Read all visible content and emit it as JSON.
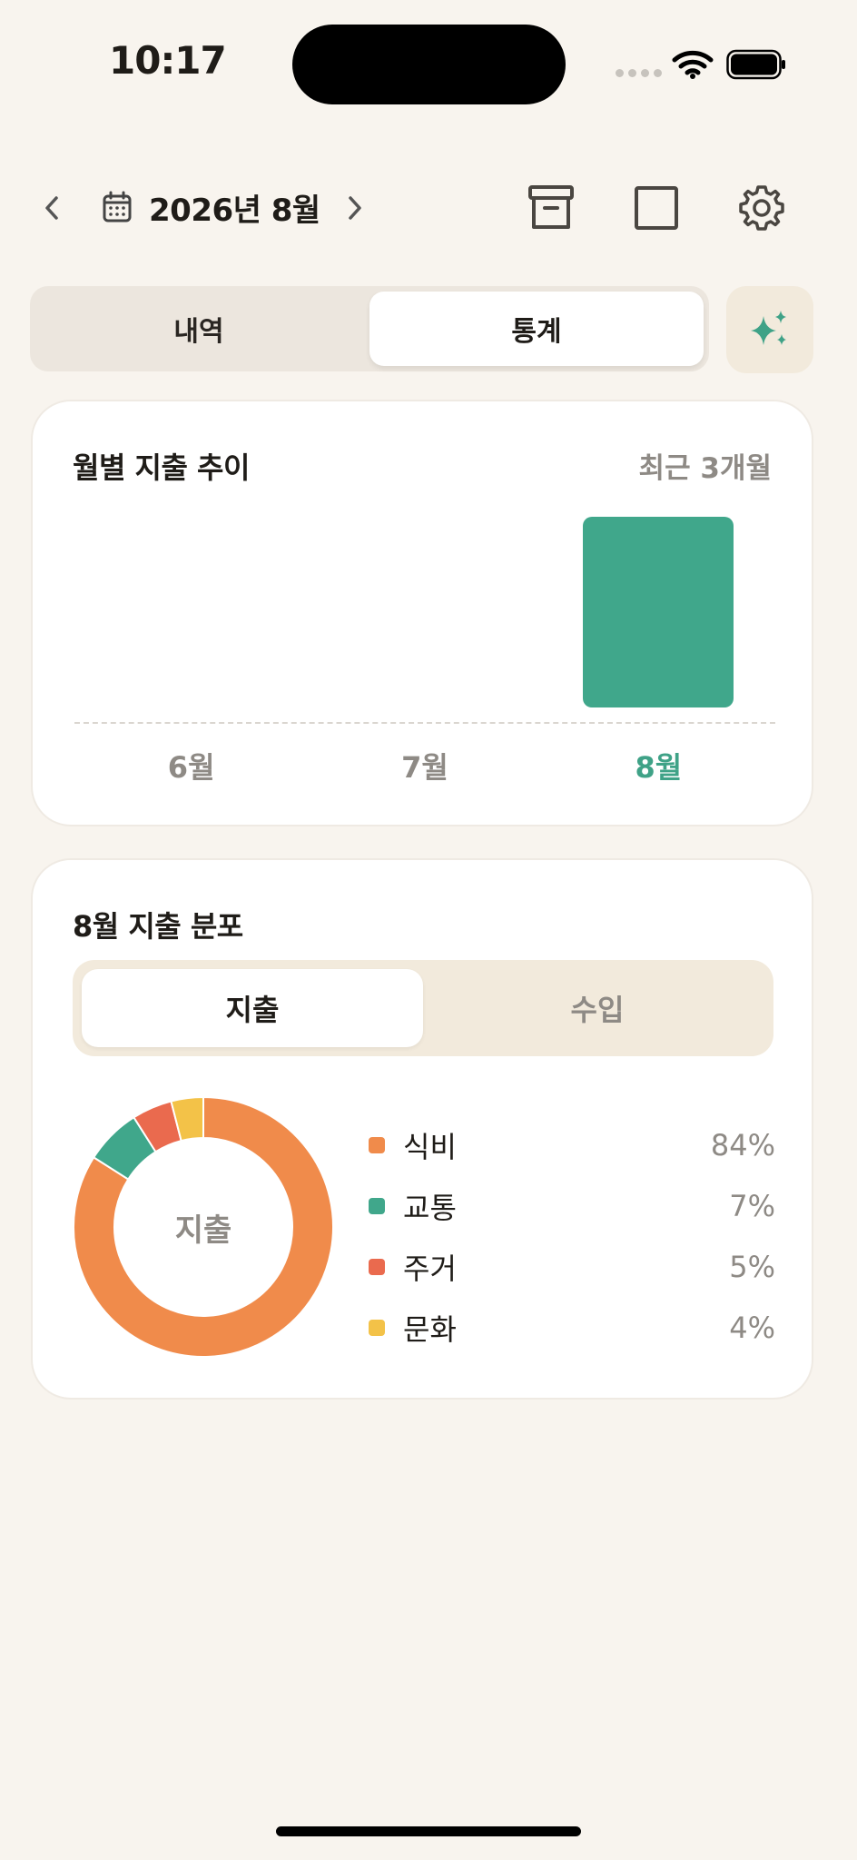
{
  "status_bar": {
    "time": "10:17"
  },
  "header": {
    "month_title": "2026년 8월"
  },
  "tabs": {
    "items": [
      "내역",
      "통계"
    ],
    "selected": "통계"
  },
  "trend_card": {
    "title": "월별 지출 추이",
    "range_label": "최근 3개월"
  },
  "chart_data": {
    "type": "bar",
    "categories": [
      "6월",
      "7월",
      "8월"
    ],
    "values": [
      0,
      0,
      1
    ],
    "highlighted": "8월",
    "color": "#40A78B",
    "grid": false
  },
  "distribution_card": {
    "title": "8월 지출 분포",
    "toggle": {
      "expense_label": "지출",
      "income_label": "수입",
      "selected": "지출"
    },
    "donut_center_label": "지출",
    "items": [
      {
        "name": "식비",
        "percent": 84,
        "percent_label": "84%",
        "color": "#F08B4B"
      },
      {
        "name": "교통",
        "percent": 7,
        "percent_label": "7%",
        "color": "#40A78B"
      },
      {
        "name": "주거",
        "percent": 5,
        "percent_label": "5%",
        "color": "#EA6A4E"
      },
      {
        "name": "문화",
        "percent": 4,
        "percent_label": "4%",
        "color": "#F3C248"
      }
    ]
  },
  "colors": {
    "background": "#F8F4EE",
    "accent": "#40A78B",
    "card": "#FFFFFF"
  }
}
